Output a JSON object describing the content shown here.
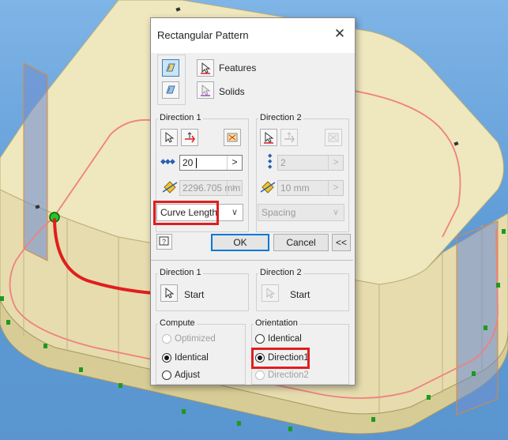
{
  "dialog": {
    "title": "Rectangular Pattern",
    "close_glyph": "✕",
    "features_label": "Features",
    "solids_label": "Solids",
    "direction1": {
      "group_label": "Direction 1",
      "count_value": "20",
      "length_value": "2296.705 mm",
      "distribution_value": "Curve Length"
    },
    "direction2": {
      "group_label": "Direction 2",
      "count_value": "2",
      "length_value": "10 mm",
      "distribution_value": "Spacing"
    },
    "ok_label": "OK",
    "cancel_label": "Cancel",
    "more_label": "<<",
    "start": {
      "dir1_label": "Direction 1",
      "dir1_start_label": "Start",
      "dir2_label": "Direction 2",
      "dir2_start_label": "Start"
    },
    "compute": {
      "group_label": "Compute",
      "options": [
        "Optimized",
        "Identical",
        "Adjust"
      ],
      "selected": "Identical"
    },
    "orientation": {
      "group_label": "Orientation",
      "options": [
        "Identical",
        "Direction1",
        "Direction2"
      ],
      "selected": "Direction1"
    }
  },
  "icons": {
    "pattern_features": "pattern-features-icon",
    "pattern_solids": "pattern-solids-icon",
    "select_arrow": "cursor-arrow-icon",
    "flip": "flip-direction-icon",
    "midplane": "midplane-icon",
    "count": "count-dots-icon",
    "length": "length-measure-icon",
    "help": "help-icon"
  },
  "colors": {
    "highlight": "#e01e1e",
    "selected_button": "#cce4f7",
    "default_button_border": "#0078d7",
    "model_body": "#efe7bd",
    "model_edge": "#f08080"
  }
}
